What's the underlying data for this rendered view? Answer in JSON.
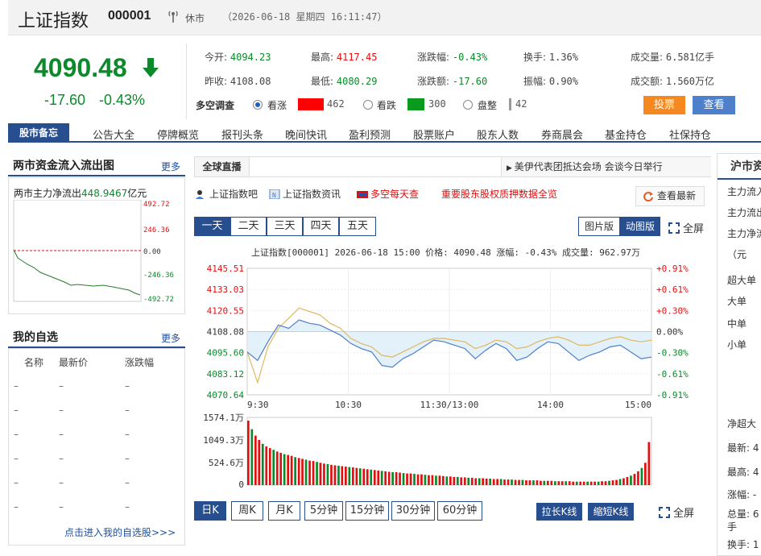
{
  "header": {
    "name": "上证指数",
    "code": "000001",
    "status": "休市",
    "datetime": "（2026-06-18 星期四 16:11:47）"
  },
  "quote": {
    "price": "4090.48",
    "change": "-17.60",
    "change_pct": "-0.43%"
  },
  "stats": {
    "open_l": "今开:",
    "open": "4094.23",
    "high_l": "最高:",
    "high": "4117.45",
    "chgpct_l": "涨跌幅:",
    "chgpct": "-0.43%",
    "turn_l": "换手:",
    "turn": "1.36%",
    "vol_l": "成交量:",
    "vol": "6.581亿手",
    "prev_l": "昨收:",
    "prev": "4108.08",
    "low_l": "最低:",
    "low": "4080.29",
    "chg_l": "涨跌额:",
    "chg": "-17.60",
    "amp_l": "振幅:",
    "amp": "0.90%",
    "amt_l": "成交额:",
    "amt": "1.560万亿"
  },
  "survey": {
    "label": "多空调查",
    "bull": "看涨",
    "bull_n": "462",
    "bear": "看跌",
    "bear_n": "300",
    "flat": "盘整",
    "flat_n": "42",
    "vote": "投票",
    "view": "查看",
    "bull_color": "#ff0000",
    "bear_color": "#0a9a1e"
  },
  "nav": {
    "memo": "股市备忘",
    "items": [
      "公告大全",
      "停牌概览",
      "报刊头条",
      "晚间快讯",
      "盈利预测",
      "股票账户",
      "股东人数",
      "券商晨会",
      "基金持仓",
      "社保持仓"
    ]
  },
  "fund_flow": {
    "title": "两市资金流入流出图",
    "more": "更多",
    "label": "两市主力净流出",
    "value": "448.9467",
    "unit": "亿元",
    "axis": [
      "492.72",
      "246.36",
      "0.00",
      "-246.36",
      "-492.72"
    ]
  },
  "watchlist": {
    "title": "我的自选",
    "more": "更多",
    "cols": [
      "名称",
      "最新价",
      "涨跌幅"
    ],
    "row_dash": "–",
    "link": "点击进入我的自选股>>>"
  },
  "live": {
    "label": "全球直播",
    "news": "美伊代表团抵达会场 会谈今日举行"
  },
  "links": {
    "bar": "上证指数吧",
    "info": "上证指数资讯",
    "daily": "多空每天查",
    "pledge": "重要股东股权质押数据全览",
    "latest": "查看最新"
  },
  "period_tabs": [
    "一天",
    "二天",
    "三天",
    "四天",
    "五天"
  ],
  "view": {
    "pic": "图片版",
    "dyn": "动图版",
    "full": "全屏"
  },
  "k_tabs": [
    "日K",
    "周K",
    "月K",
    "5分钟",
    "15分钟",
    "30分钟",
    "60分钟"
  ],
  "k_btns": {
    "long": "拉长K线",
    "short": "缩短K线",
    "full": "全屏"
  },
  "right_panel": {
    "title": "沪市资",
    "rows": [
      "主力流入",
      "主力流出",
      "主力净流",
      "（元",
      "超大单",
      "大单",
      "中单",
      "小单",
      "净超大",
      "最新: 4",
      "最高: 4",
      "涨幅: -",
      "总量: 6",
      "手",
      "换手: 1"
    ]
  },
  "chart_data": {
    "type": "line",
    "title": "上证指数[000001]  2026-06-18 15:00  价格: 4090.48  涨幅: -0.43%  成交量: 962.97万",
    "y_left": [
      "4145.51",
      "4133.03",
      "4120.55",
      "4108.08",
      "4095.60",
      "4083.12",
      "4070.64"
    ],
    "y_right": [
      "+0.91%",
      "+0.61%",
      "+0.30%",
      "0.00%",
      "-0.30%",
      "-0.61%",
      "-0.91%"
    ],
    "x_labels": [
      "9:30",
      "10:30",
      "11:30/13:00",
      "14:00",
      "15:00"
    ],
    "ylim": [
      4070.64,
      4145.51
    ],
    "prev_close": 4108.08,
    "series": [
      {
        "color": "#4d7fcb",
        "values": [
          4096,
          4091,
          4102,
          4112,
          4110,
          4115,
          4113,
          4112,
          4109,
          4106,
          4101,
          4098,
          4096,
          4088,
          4087,
          4092,
          4095,
          4099,
          4103,
          4102,
          4100,
          4098,
          4092,
          4097,
          4101,
          4098,
          4091,
          4093,
          4098,
          4102,
          4101,
          4096,
          4091,
          4094,
          4096,
          4099,
          4100,
          4096,
          4092,
          4093
        ]
      },
      {
        "color": "#e0b860",
        "values": [
          4096,
          4078,
          4099,
          4110,
          4116,
          4122,
          4120,
          4118,
          4113,
          4110,
          4104,
          4101,
          4099,
          4094,
          4093,
          4096,
          4099,
          4102,
          4104,
          4104,
          4103,
          4102,
          4098,
          4100,
          4103,
          4102,
          4098,
          4099,
          4102,
          4104,
          4105,
          4103,
          4100,
          4100,
          4102,
          4104,
          4105,
          4103,
          4102,
          4103
        ]
      }
    ],
    "volume": {
      "labels": [
        "1574.1万",
        "1049.3万",
        "524.6万",
        "0"
      ],
      "max": 1574.1,
      "values": [
        1500,
        1300,
        1150,
        1050,
        960,
        900,
        860,
        820,
        780,
        750,
        720,
        700,
        680,
        650,
        630,
        610,
        590,
        570,
        560,
        540,
        520,
        500,
        490,
        470,
        460,
        450,
        440,
        430,
        420,
        410,
        400,
        390,
        380,
        370,
        360,
        350,
        340,
        330,
        320,
        310,
        300,
        300,
        290,
        280,
        270,
        270,
        260,
        250,
        250,
        240,
        230,
        230,
        220,
        220,
        210,
        200,
        200,
        190,
        190,
        180,
        180,
        170,
        170,
        160,
        160,
        160,
        150,
        150,
        140,
        140,
        140,
        130,
        130,
        130,
        120,
        120,
        120,
        110,
        110,
        110,
        110,
        100,
        100,
        100,
        100,
        90,
        90,
        90,
        90,
        90,
        80,
        80,
        80,
        80,
        80,
        80,
        80,
        80,
        90,
        90,
        100,
        110,
        120,
        140,
        160,
        190,
        220,
        260,
        320,
        400,
        520,
        1000
      ]
    }
  }
}
